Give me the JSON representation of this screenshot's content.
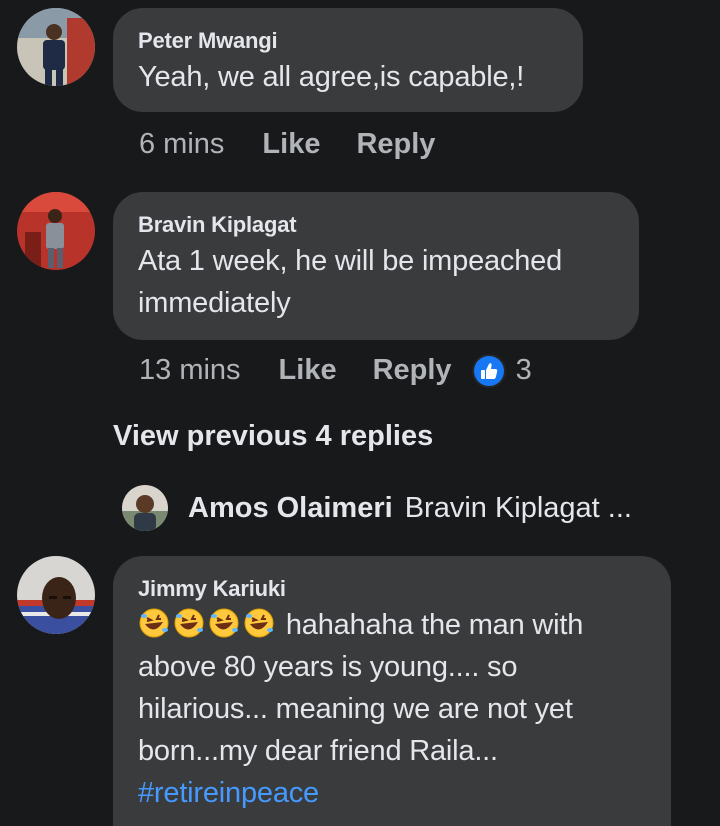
{
  "comments": [
    {
      "author": "Peter Mwangi",
      "text": "Yeah, we all agree,is capable,!",
      "time": "6 mins",
      "like_label": "Like",
      "reply_label": "Reply"
    },
    {
      "author": "Bravin Kiplagat",
      "text_line1": "Ata  1 week, he will be impeached",
      "text_line2": "immediately",
      "time": "13 mins",
      "like_label": "Like",
      "reply_label": "Reply",
      "reaction_count": "3"
    },
    {
      "author": "Jimmy Kariuki",
      "text_line1": "hahahaha the man with",
      "text_line2": "above 80 years is young.... so",
      "text_line3": "hilarious... meaning we are not yet",
      "text_line4": "born...my dear friend Raila...",
      "hashtag": "#retireinpeace"
    }
  ],
  "view_previous": "View previous 4 replies",
  "reply_preview": {
    "author": "Amos Olaimeri",
    "text": "Bravin Kiplagat ..."
  },
  "colors": {
    "background": "#18191a",
    "bubble": "#3a3b3c",
    "text": "#e4e6eb",
    "muted": "#b0b3b8",
    "link": "#4599ff",
    "like_blue": "#1877f2"
  },
  "icons": {
    "reaction": "like-thumb-icon",
    "emoji": "rolling-on-floor-laughing-emoji"
  }
}
